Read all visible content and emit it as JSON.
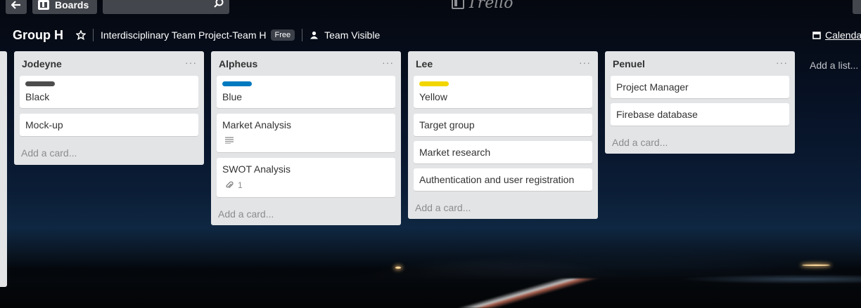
{
  "topbar": {
    "boards_label": "Boards",
    "logo_text": "Trello",
    "search_placeholder": ""
  },
  "board": {
    "title": "Group H",
    "team_name": "Interdisciplinary Team Project-Team H",
    "team_badge": "Free",
    "visibility": "Team Visible",
    "calendar_label": "Calendar"
  },
  "lists": [
    {
      "title": "Jodeyne",
      "menu": "···",
      "cards": [
        {
          "text": "Black",
          "label_color": "#4d4d4d"
        },
        {
          "text": "Mock-up"
        }
      ],
      "add_card": "Add a card..."
    },
    {
      "title": "Alpheus",
      "menu": "···",
      "cards": [
        {
          "text": "Blue",
          "label_color": "#0079bf"
        },
        {
          "text": "Market Analysis",
          "badge": "description-icon"
        },
        {
          "text": "SWOT Analysis",
          "badge": "attachment-icon",
          "attachments": "1"
        }
      ],
      "add_card": "Add a card..."
    },
    {
      "title": "Lee",
      "menu": "···",
      "cards": [
        {
          "text": "Yellow",
          "label_color": "#f2d600"
        },
        {
          "text": "Target group"
        },
        {
          "text": "Market research"
        },
        {
          "text": "Authentication and user registration"
        }
      ],
      "add_card": "Add a card..."
    },
    {
      "title": "Penuel",
      "menu": "···",
      "cards": [
        {
          "text": "Project Manager"
        },
        {
          "text": "Firebase database"
        }
      ],
      "add_card": "Add a card..."
    }
  ],
  "add_list": "Add a list..."
}
